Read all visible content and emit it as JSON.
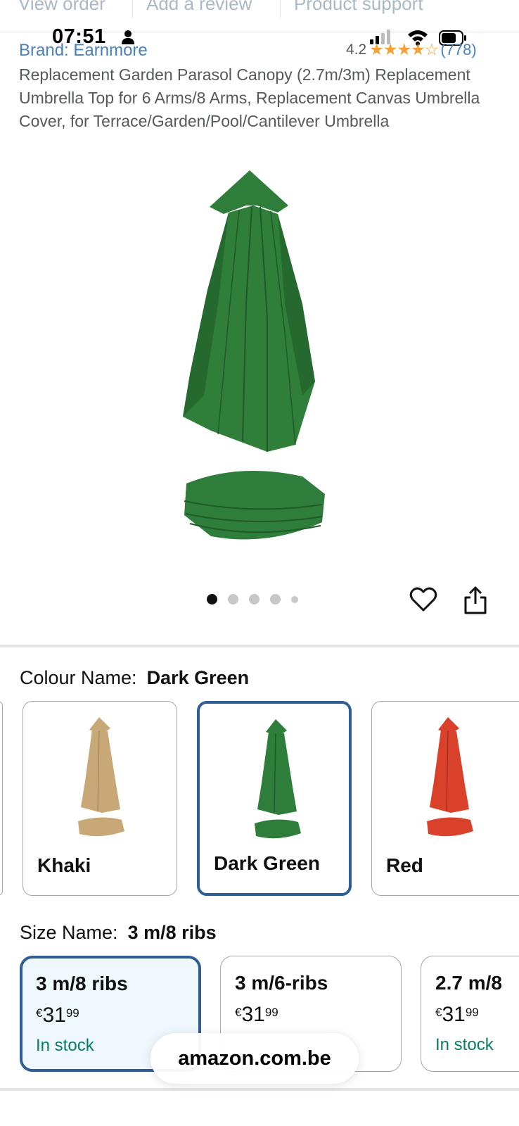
{
  "top_tabs": [
    "View order",
    "Add a review",
    "Product support"
  ],
  "status_bar": {
    "time": "07:51"
  },
  "product": {
    "brand": "Brand: Earnmore",
    "rating_value": "4.2",
    "rating_count": "(778)",
    "rating_stars": 4.2,
    "title": "Replacement Garden Parasol Canopy (2.7m/3m) Replacement Umbrella Top for 6 Arms/8 Arms, Replacement Canvas Umbrella Cover, for Terrace/Garden/Pool/Cantilever Umbrella"
  },
  "gallery": {
    "image_count": 5,
    "active_index": 0
  },
  "colour": {
    "label": "Colour Name:",
    "selected": "Dark Green",
    "options": [
      {
        "name": "Khaki",
        "color": "#c9a878"
      },
      {
        "name": "Dark Green",
        "color": "#2e7d3a"
      },
      {
        "name": "Red",
        "color": "#d9412b"
      }
    ]
  },
  "size": {
    "label": "Size Name:",
    "selected": "3 m/8 ribs",
    "options": [
      {
        "name": "3 m/8 ribs",
        "currency": "€",
        "price_whole": "31",
        "price_cents": "99",
        "stock": "In stock"
      },
      {
        "name": "3 m/6-ribs",
        "currency": "€",
        "price_whole": "31",
        "price_cents": "99",
        "stock": ""
      },
      {
        "name": "2.7 m/8",
        "currency": "€",
        "price_whole": "31",
        "price_cents": "99",
        "stock": "In stock"
      }
    ]
  },
  "browser": {
    "url": "amazon.com.be"
  },
  "colors": {
    "link": "#4a7fbd",
    "selected_border": "#2f5e95",
    "stock_green": "#067d62",
    "star": "#f7a03a"
  }
}
